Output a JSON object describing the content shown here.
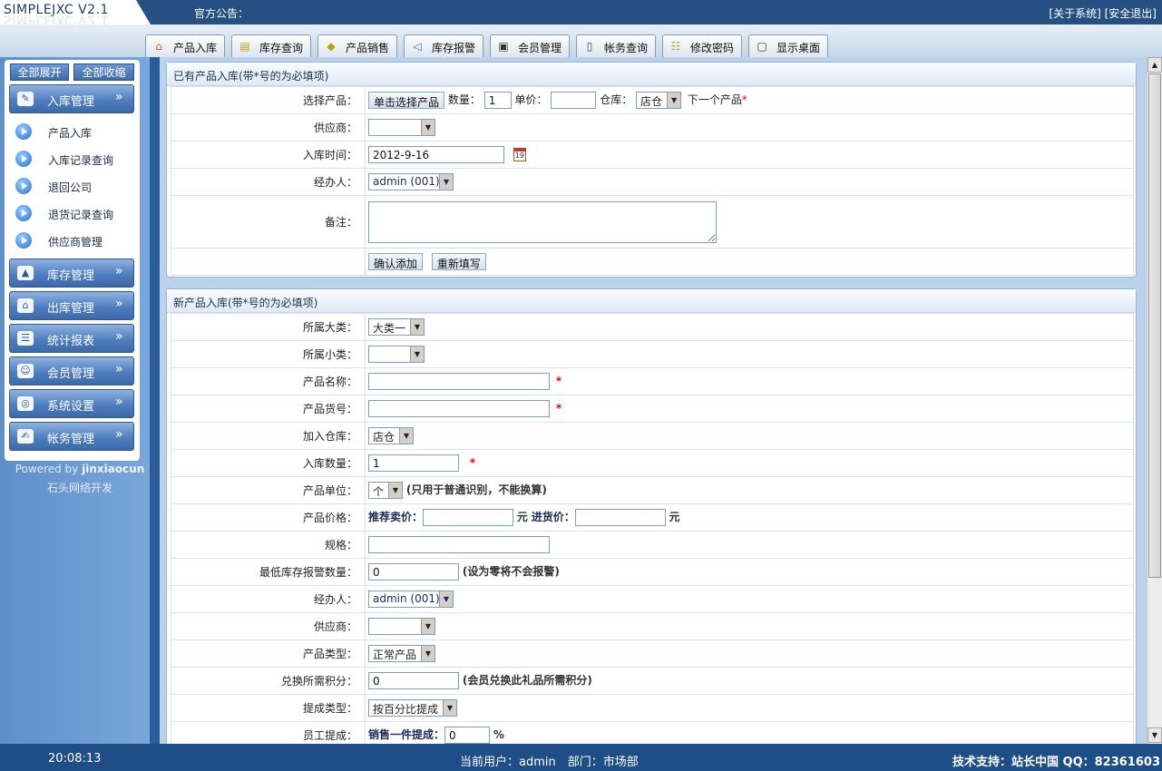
{
  "app": {
    "title": "SIMPLEJXC V2.1",
    "notice_label": "官方公告：",
    "about": "[关于系统]",
    "logout": "[安全退出]"
  },
  "tabs": [
    {
      "label": "产品入库",
      "icon": "house-icon"
    },
    {
      "label": "库存查询",
      "icon": "folder-icon"
    },
    {
      "label": "产品销售",
      "icon": "tag-icon"
    },
    {
      "label": "库存报警",
      "icon": "speaker-icon"
    },
    {
      "label": "会员管理",
      "icon": "member-icon"
    },
    {
      "label": "帐务查询",
      "icon": "bottle-icon"
    },
    {
      "label": "修改密码",
      "icon": "key-icon"
    },
    {
      "label": "显示桌面",
      "icon": "desktop-icon"
    }
  ],
  "sidebar": {
    "expand_all": "全部展开",
    "collapse_all": "全部收缩",
    "menus": [
      {
        "label": "入库管理",
        "icon": "stock-in-icon"
      },
      {
        "label": "库存管理",
        "icon": "stock-icon"
      },
      {
        "label": "出库管理",
        "icon": "stock-out-icon"
      },
      {
        "label": "统计报表",
        "icon": "report-icon"
      },
      {
        "label": "会员管理",
        "icon": "member-icon"
      },
      {
        "label": "系统设置",
        "icon": "globe-icon"
      },
      {
        "label": "帐务管理",
        "icon": "account-icon"
      }
    ],
    "chevron": "»",
    "subitems": [
      "产品入库",
      "入库记录查询",
      "退回公司",
      "退货记录查询",
      "供应商管理"
    ],
    "powered_prefix": "Powered by ",
    "powered_brand": "jinxiaocun",
    "company": "石头网络开发"
  },
  "existing": {
    "title": "已有产品入库(带*号的为必填项)",
    "select_label": "选择产品：",
    "select_btn": "单击选择产品",
    "qty_label": "数量：",
    "qty_value": "1",
    "price_label": "单价：",
    "price_value": "",
    "warehouse_label": "仓库：",
    "warehouse_value": "店仓",
    "next_label": "下一个产品",
    "star": "*",
    "supplier_label": "供应商：",
    "supplier_value": "",
    "date_label": "入库时间：",
    "date_value": "2012-9-16",
    "calendar_day": "19",
    "handler_label": "经办人：",
    "handler_value": "admin (001)",
    "remark_label": "备注：",
    "confirm_btn": "确认添加",
    "reset_btn": "重新填写"
  },
  "newproduct": {
    "title": "新产品入库(带*号的为必填项)",
    "rows": {
      "cat1_label": "所属大类：",
      "cat1_value": "大类一",
      "cat2_label": "所属小类：",
      "cat2_value": "",
      "name_label": "产品名称：",
      "code_label": "产品货号：",
      "wh_label": "加入仓库：",
      "wh_value": "店仓",
      "qty_label": "入库数量：",
      "qty_value": "1",
      "unit_label": "产品单位：",
      "unit_value": "个",
      "unit_note": "(只用于普通识别，不能换算)",
      "price_label": "产品价格：",
      "sell_label": "推荐卖价：",
      "yuan": "元",
      "buy_label": "进货价：",
      "spec_label": "规格：",
      "alarm_label": "最低库存报警数量：",
      "alarm_value": "0",
      "alarm_note": "(设为零将不会报警)",
      "handler_label": "经办人：",
      "handler_value": "admin (001)",
      "supplier_label": "供应商：",
      "supplier_value": "",
      "type_label": "产品类型：",
      "type_value": "正常产品",
      "points_label": "兑换所需积分：",
      "points_value": "0",
      "points_note": "(会员兑换此礼品所需积分)",
      "comm_type_label": "提成类型：",
      "comm_type_value": "按百分比提成",
      "staff_label": "员工提成：",
      "staff_sub": "销售一件提成：",
      "staff_value": "0",
      "percent": "%"
    }
  },
  "status": {
    "clock": "20:08:13",
    "current": "当前用户：admin　部门：市场部",
    "support": "技术支持：站长中国 QQ：82361603"
  }
}
